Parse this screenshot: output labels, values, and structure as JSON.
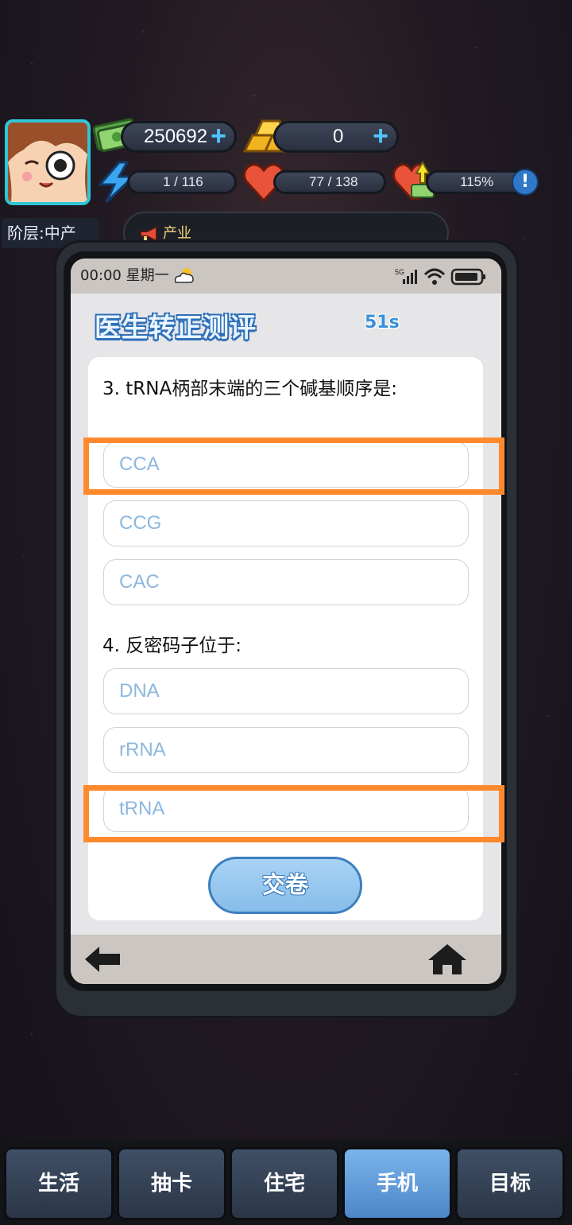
{
  "hud": {
    "money": "250692",
    "gold": "0",
    "energy": "1 / 116",
    "health": "77 / 138",
    "happiness": "115%",
    "tier": "阶层:中产",
    "news": "产业",
    "colors": {
      "accent": "#52c6ff",
      "pill": "#2a3040",
      "highlight": "#ff8a2e"
    }
  },
  "phone": {
    "statusbar": {
      "time": "00:00 星期一",
      "network": "5G"
    },
    "quiz": {
      "title": "医生转正测评",
      "timer": "51s",
      "questions": [
        {
          "text": "3. tRNA柄部末端的三个碱基顺序是:",
          "options": [
            "CCA",
            "CCG",
            "CAC"
          ]
        },
        {
          "text": "4. 反密码子位于:",
          "options": [
            "DNA",
            "rRNA",
            "tRNA"
          ]
        }
      ],
      "submit_label": "交卷"
    }
  },
  "tabs": [
    {
      "label": "生活",
      "active": false
    },
    {
      "label": "抽卡",
      "active": false
    },
    {
      "label": "住宅",
      "active": false
    },
    {
      "label": "手机",
      "active": true
    },
    {
      "label": "目标",
      "active": false
    }
  ]
}
